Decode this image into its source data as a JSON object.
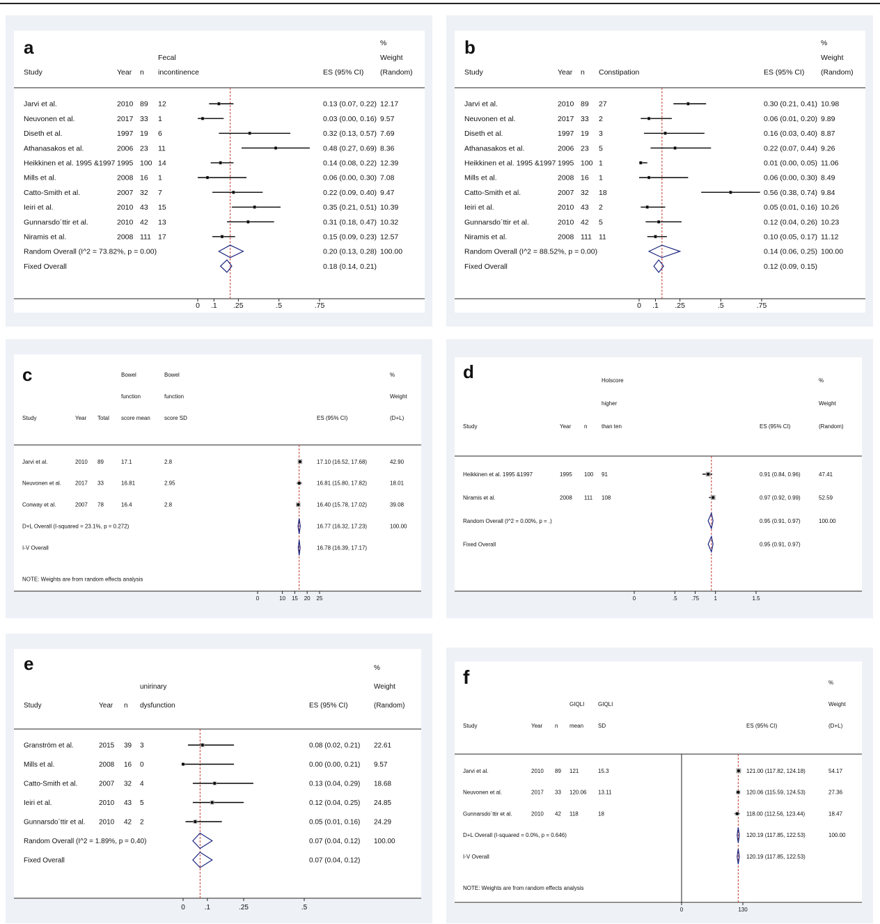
{
  "chart_data": [
    {
      "type": "forest",
      "letter": "a",
      "headers": [
        [
          "Study",
          "Year",
          "n",
          "Fecal",
          "incontinence",
          "ES (95% CI)",
          "%",
          "Weight",
          "(Random)"
        ]
      ],
      "header_lines": {
        "col4": [
          "Fecal",
          "incontinence"
        ],
        "weight": [
          "%",
          "Weight",
          "(Random)"
        ]
      },
      "xlim": [
        0,
        0.75
      ],
      "ticks": [
        0,
        0.1,
        0.25,
        0.5,
        0.75
      ],
      "tick_labels": [
        "0",
        ".1",
        ".25",
        ".5",
        ".75"
      ],
      "ref_line": 0.2,
      "studies": [
        {
          "study": "Jarvi et al.",
          "year": "2010",
          "n": "89",
          "v": "12",
          "es": 0.13,
          "lo": 0.07,
          "hi": 0.22,
          "es_text": "0.13 (0.07, 0.22)",
          "weight": "12.17"
        },
        {
          "study": "Neuvonen et al.",
          "year": "2017",
          "n": "33",
          "v": "1",
          "es": 0.03,
          "lo": 0.0,
          "hi": 0.16,
          "es_text": "0.03 (0.00, 0.16)",
          "weight": "9.57"
        },
        {
          "study": "Diseth et al.",
          "year": "1997",
          "n": "19",
          "v": "6",
          "es": 0.32,
          "lo": 0.13,
          "hi": 0.57,
          "es_text": "0.32 (0.13, 0.57)",
          "weight": "7.69"
        },
        {
          "study": "Athanasakos et al.",
          "year": "2006",
          "n": "23",
          "v": "11",
          "es": 0.48,
          "lo": 0.27,
          "hi": 0.69,
          "es_text": "0.48 (0.27, 0.69)",
          "weight": "8.36"
        },
        {
          "study": "Heikkinen et al. 1995 &1997",
          "year": "1995",
          "n": "100",
          "v": "14",
          "es": 0.14,
          "lo": 0.08,
          "hi": 0.22,
          "es_text": "0.14 (0.08, 0.22)",
          "weight": "12.39"
        },
        {
          "study": "Mills et al.",
          "year": "2008",
          "n": "16",
          "v": "1",
          "es": 0.06,
          "lo": 0.0,
          "hi": 0.3,
          "es_text": "0.06 (0.00, 0.30)",
          "weight": "7.08"
        },
        {
          "study": "Catto-Smith et al.",
          "year": "2007",
          "n": "32",
          "v": "7",
          "es": 0.22,
          "lo": 0.09,
          "hi": 0.4,
          "es_text": "0.22 (0.09, 0.40)",
          "weight": "9.47"
        },
        {
          "study": "Ieiri et al.",
          "year": "2010",
          "n": "43",
          "v": "15",
          "es": 0.35,
          "lo": 0.21,
          "hi": 0.51,
          "es_text": "0.35 (0.21, 0.51)",
          "weight": "10.39"
        },
        {
          "study": "Gunnarsdo´ttir et al.",
          "year": "2010",
          "n": "42",
          "v": "13",
          "es": 0.31,
          "lo": 0.18,
          "hi": 0.47,
          "es_text": "0.31 (0.18, 0.47)",
          "weight": "10.32"
        },
        {
          "study": "Niramis et al.",
          "year": "2008",
          "n": "111",
          "v": "17",
          "es": 0.15,
          "lo": 0.09,
          "hi": 0.23,
          "es_text": "0.15 (0.09, 0.23)",
          "weight": "12.57"
        }
      ],
      "overall": [
        {
          "label": "Random Overall  (I^2 = 73.82%, p = 0.00)",
          "es": 0.2,
          "lo": 0.13,
          "hi": 0.28,
          "es_text": "0.20 (0.13, 0.28)",
          "weight": "100.00"
        },
        {
          "label": "Fixed Overall",
          "es": 0.18,
          "lo": 0.14,
          "hi": 0.21,
          "es_text": "0.18 (0.14, 0.21)",
          "weight": ""
        }
      ],
      "note": ""
    },
    {
      "type": "forest",
      "letter": "b",
      "header_lines": {
        "col4": [
          "Constipation"
        ],
        "weight": [
          "%",
          "Weight",
          "(Random)"
        ]
      },
      "xlim": [
        0,
        0.75
      ],
      "ticks": [
        0,
        0.1,
        0.25,
        0.5,
        0.75
      ],
      "tick_labels": [
        "0",
        ".1",
        ".25",
        ".5",
        ".75"
      ],
      "ref_line": 0.14,
      "studies": [
        {
          "study": "Jarvi et al.",
          "year": "2010",
          "n": "89",
          "v": "27",
          "es": 0.3,
          "lo": 0.21,
          "hi": 0.41,
          "es_text": "0.30 (0.21, 0.41)",
          "weight": "10.98"
        },
        {
          "study": "Neuvonen et al.",
          "year": "2017",
          "n": "33",
          "v": "2",
          "es": 0.06,
          "lo": 0.01,
          "hi": 0.2,
          "es_text": "0.06 (0.01, 0.20)",
          "weight": "9.89"
        },
        {
          "study": "Diseth et al.",
          "year": "1997",
          "n": "19",
          "v": "3",
          "es": 0.16,
          "lo": 0.03,
          "hi": 0.4,
          "es_text": "0.16 (0.03, 0.40)",
          "weight": "8.87"
        },
        {
          "study": "Athanasakos et al.",
          "year": "2006",
          "n": "23",
          "v": "5",
          "es": 0.22,
          "lo": 0.07,
          "hi": 0.44,
          "es_text": "0.22 (0.07, 0.44)",
          "weight": "9.26"
        },
        {
          "study": "Heikkinen et al. 1995 &1997",
          "year": "1995",
          "n": "100",
          "v": "1",
          "es": 0.01,
          "lo": 0.0,
          "hi": 0.05,
          "es_text": "0.01 (0.00, 0.05)",
          "weight": "11.06"
        },
        {
          "study": "Mills et al.",
          "year": "2008",
          "n": "16",
          "v": "1",
          "es": 0.06,
          "lo": 0.0,
          "hi": 0.3,
          "es_text": "0.06 (0.00, 0.30)",
          "weight": "8.49"
        },
        {
          "study": "Catto-Smith et al.",
          "year": "2007",
          "n": "32",
          "v": "18",
          "es": 0.56,
          "lo": 0.38,
          "hi": 0.74,
          "es_text": "0.56 (0.38, 0.74)",
          "weight": "9.84"
        },
        {
          "study": "Ieiri et al.",
          "year": "2010",
          "n": "43",
          "v": "2",
          "es": 0.05,
          "lo": 0.01,
          "hi": 0.16,
          "es_text": "0.05 (0.01, 0.16)",
          "weight": "10.26"
        },
        {
          "study": "Gunnarsdo´ttir et al.",
          "year": "2010",
          "n": "42",
          "v": "5",
          "es": 0.12,
          "lo": 0.04,
          "hi": 0.26,
          "es_text": "0.12 (0.04, 0.26)",
          "weight": "10.23"
        },
        {
          "study": "Niramis et al.",
          "year": "2008",
          "n": "111",
          "v": "11",
          "es": 0.1,
          "lo": 0.05,
          "hi": 0.17,
          "es_text": "0.10 (0.05, 0.17)",
          "weight": "11.12"
        }
      ],
      "overall": [
        {
          "label": "Random Overall  (I^2 = 88.52%, p = 0.00)",
          "es": 0.14,
          "lo": 0.06,
          "hi": 0.25,
          "es_text": "0.14 (0.06, 0.25)",
          "weight": "100.00"
        },
        {
          "label": "Fixed Overall",
          "es": 0.12,
          "lo": 0.09,
          "hi": 0.15,
          "es_text": "0.12 (0.09, 0.15)",
          "weight": ""
        }
      ],
      "note": ""
    },
    {
      "type": "forest",
      "letter": "c",
      "header_lines": {
        "col4": [
          "Bowel",
          "function",
          "score mean"
        ],
        "col5": [
          "Bowel",
          "function",
          "score SD"
        ],
        "weight": [
          "%",
          "Weight",
          "(D+L)"
        ]
      },
      "col_labels": [
        "Study",
        "Year",
        "Total"
      ],
      "xlim": [
        0,
        25
      ],
      "ticks": [
        0,
        10,
        15,
        20,
        25
      ],
      "tick_labels": [
        "0",
        "10",
        "15",
        "20",
        "25"
      ],
      "ref_line": 16.77,
      "studies": [
        {
          "study": "Jarvi et al.",
          "year": "2010",
          "n": "89",
          "v": "17.1",
          "v2": "2.8",
          "es": 17.1,
          "lo": 16.52,
          "hi": 17.68,
          "es_text": "17.10 (16.52, 17.68)",
          "weight": "42.90"
        },
        {
          "study": "Neuvonen et al.",
          "year": "2017",
          "n": "33",
          "v": "16.81",
          "v2": "2.95",
          "es": 16.81,
          "lo": 15.8,
          "hi": 17.82,
          "es_text": "16.81 (15.80, 17.82)",
          "weight": "18.01"
        },
        {
          "study": "Conway et al.",
          "year": "2007",
          "n": "78",
          "v": "16.4",
          "v2": "2.8",
          "es": 16.4,
          "lo": 15.78,
          "hi": 17.02,
          "es_text": "16.40 (15.78, 17.02)",
          "weight": "39.08"
        }
      ],
      "overall": [
        {
          "label": "D+L Overall  (I-squared = 23.1%, p = 0.272)",
          "es": 16.77,
          "lo": 16.32,
          "hi": 17.23,
          "es_text": "16.77 (16.32, 17.23)",
          "weight": "100.00"
        },
        {
          "label": "I-V Overall",
          "es": 16.78,
          "lo": 16.39,
          "hi": 17.17,
          "es_text": "16.78 (16.39, 17.17)",
          "weight": ""
        }
      ],
      "note": "NOTE: Weights are from random effects analysis"
    },
    {
      "type": "forest",
      "letter": "d",
      "header_lines": {
        "col4": [
          "Holscore",
          "higher",
          "than ten"
        ],
        "weight": [
          "%",
          "Weight",
          "(Random)"
        ]
      },
      "xlim": [
        0,
        1.5
      ],
      "ticks": [
        0,
        0.5,
        0.75,
        1,
        1.5
      ],
      "tick_labels": [
        "0",
        ".5",
        ".75",
        "1",
        "1.5"
      ],
      "ref_line": 0.95,
      "studies": [
        {
          "study": "Heikkinen et al. 1995 &1997",
          "year": "1995",
          "n": "100",
          "v": "91",
          "es": 0.91,
          "lo": 0.84,
          "hi": 0.96,
          "es_text": "0.91 (0.84, 0.96)",
          "weight": "47.41"
        },
        {
          "study": "Niramis et al.",
          "year": "2008",
          "n": "111",
          "v": "108",
          "es": 0.97,
          "lo": 0.92,
          "hi": 0.99,
          "es_text": "0.97 (0.92, 0.99)",
          "weight": "52.59"
        }
      ],
      "overall": [
        {
          "label": "Random Overall  (I^2 = 0.00%, p = .)",
          "es": 0.95,
          "lo": 0.91,
          "hi": 0.97,
          "es_text": "0.95 (0.91, 0.97)",
          "weight": "100.00"
        },
        {
          "label": "Fixed Overall",
          "es": 0.95,
          "lo": 0.91,
          "hi": 0.97,
          "es_text": "0.95 (0.91, 0.97)",
          "weight": ""
        }
      ],
      "note": ""
    },
    {
      "type": "forest",
      "letter": "e",
      "header_lines": {
        "col4": [
          "unirinary",
          "dysfunction"
        ],
        "weight": [
          "%",
          "Weight",
          "(Random)"
        ]
      },
      "xlim": [
        0,
        0.5
      ],
      "ticks": [
        0,
        0.1,
        0.25,
        0.5
      ],
      "tick_labels": [
        "0",
        ".1",
        ".25",
        ".5"
      ],
      "ref_line": 0.07,
      "studies": [
        {
          "study": "Granström et al.",
          "year": "2015",
          "n": "39",
          "v": "3",
          "es": 0.08,
          "lo": 0.02,
          "hi": 0.21,
          "es_text": "0.08 (0.02, 0.21)",
          "weight": "22.61"
        },
        {
          "study": "Mills et al.",
          "year": "2008",
          "n": "16",
          "v": "0",
          "es": 0.0,
          "lo": 0.0,
          "hi": 0.21,
          "es_text": "0.00 (0.00, 0.21)",
          "weight": "9.57"
        },
        {
          "study": "Catto-Smith et al.",
          "year": "2007",
          "n": "32",
          "v": "4",
          "es": 0.13,
          "lo": 0.04,
          "hi": 0.29,
          "es_text": "0.13 (0.04, 0.29)",
          "weight": "18.68"
        },
        {
          "study": "Ieiri et al.",
          "year": "2010",
          "n": "43",
          "v": "5",
          "es": 0.12,
          "lo": 0.04,
          "hi": 0.25,
          "es_text": "0.12 (0.04, 0.25)",
          "weight": "24.85"
        },
        {
          "study": "Gunnarsdo´ttir et al.",
          "year": "2010",
          "n": "42",
          "v": "2",
          "es": 0.05,
          "lo": 0.01,
          "hi": 0.16,
          "es_text": "0.05 (0.01, 0.16)",
          "weight": "24.29"
        }
      ],
      "overall": [
        {
          "label": "Random Overall  (I^2 = 1.89%, p = 0.40)",
          "es": 0.07,
          "lo": 0.04,
          "hi": 0.12,
          "es_text": "0.07 (0.04, 0.12)",
          "weight": "100.00"
        },
        {
          "label": "Fixed Overall",
          "es": 0.07,
          "lo": 0.04,
          "hi": 0.12,
          "es_text": "0.07 (0.04, 0.12)",
          "weight": ""
        }
      ],
      "note": ""
    },
    {
      "type": "forest",
      "letter": "f",
      "header_lines": {
        "col4": [
          "GIQLI",
          "mean"
        ],
        "col5": [
          "GIQLI",
          "SD"
        ],
        "weight": [
          "%",
          "Weight",
          "(D+L)"
        ]
      },
      "xlim": [
        0,
        130
      ],
      "ticks": [
        0,
        130
      ],
      "tick_labels": [
        "0",
        "130"
      ],
      "ref_line": 120.19,
      "zero_line": true,
      "studies": [
        {
          "study": "Jarvi et al.",
          "year": "2010",
          "n": "89",
          "v": "121",
          "v2": "15.3",
          "es": 121.0,
          "lo": 117.82,
          "hi": 124.18,
          "es_text": "121.00 (117.82, 124.18)",
          "weight": "54.17"
        },
        {
          "study": "Neuvonen et al.",
          "year": "2017",
          "n": "33",
          "v": "120.06",
          "v2": "13.11",
          "es": 120.06,
          "lo": 115.59,
          "hi": 124.53,
          "es_text": "120.06 (115.59, 124.53)",
          "weight": "27.36"
        },
        {
          "study": "Gunnarsdo´ttir et al.",
          "year": "2010",
          "n": "42",
          "v": "118",
          "v2": "18",
          "es": 118.0,
          "lo": 112.56,
          "hi": 123.44,
          "es_text": "118.00 (112.56, 123.44)",
          "weight": "18.47"
        }
      ],
      "overall": [
        {
          "label": "D+L Overall  (I-squared = 0.0%, p = 0.646)",
          "es": 120.19,
          "lo": 117.85,
          "hi": 122.53,
          "es_text": "120.19 (117.85, 122.53)",
          "weight": "100.00"
        },
        {
          "label": "I-V Overall",
          "es": 120.19,
          "lo": 117.85,
          "hi": 122.53,
          "es_text": "120.19 (117.85, 122.53)",
          "weight": ""
        }
      ],
      "note": "NOTE: Weights are from random effects analysis"
    }
  ]
}
